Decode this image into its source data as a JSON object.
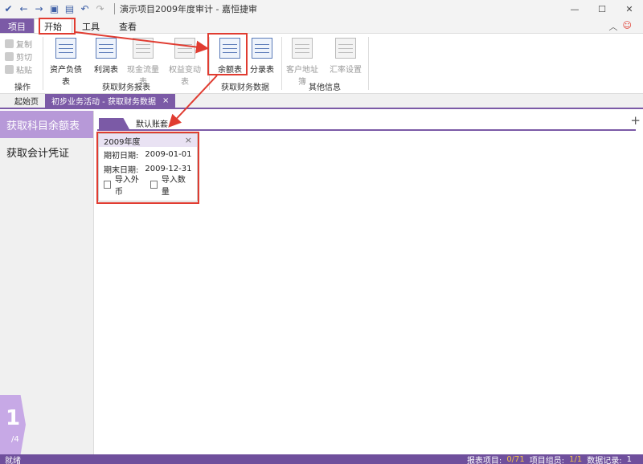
{
  "titlebar": {
    "title": "演示项目2009年度审计 - 嘉恒捷审",
    "icons": [
      "app-icon",
      "back-icon",
      "forward-icon",
      "save-icon",
      "save-as-icon",
      "undo-icon",
      "redo-icon"
    ],
    "window_buttons": [
      "minimize",
      "maximize",
      "close"
    ]
  },
  "tabs": {
    "project": "项目",
    "items": [
      "开始",
      "工具",
      "查看"
    ],
    "active": "开始"
  },
  "ribbon": {
    "ops": {
      "copy": "复制",
      "cut": "剪切",
      "paste": "粘贴",
      "label": "操作"
    },
    "reports": {
      "label": "获取财务报表",
      "items": [
        "资产负债表",
        "利润表",
        "现金流量表",
        "权益变动表"
      ]
    },
    "financial": {
      "label": "获取财务数据",
      "items": [
        "余额表",
        "分录表"
      ]
    },
    "other": {
      "label": "其他信息",
      "items": [
        "客户地址簿",
        "汇率设置"
      ]
    }
  },
  "doctabs": {
    "home": "起始页",
    "active": "初步业务活动 - 获取财务数据",
    "close": "×"
  },
  "leftnav": {
    "items": [
      "获取科目余额表",
      "获取会计凭证"
    ],
    "active_index": 0,
    "page_num": "1",
    "page_total": "/4"
  },
  "content": {
    "ledger_label": "默认账套",
    "plus": "+",
    "year_card": {
      "title": "2009年度",
      "close": "×",
      "start_label": "期初日期:",
      "start_value": "2009-01-01",
      "end_label": "期末日期:",
      "end_value": "2009-12-31",
      "import_foreign": "导入外币",
      "import_qty": "导入数量"
    }
  },
  "status": {
    "left": "就绪",
    "report_label": "报表项目:",
    "report_value": "0/71",
    "group_label": "项目组员:",
    "group_value": "1/1",
    "records_label": "数据记录:",
    "records_value": "1"
  },
  "colors": {
    "accent": "#7b5aa6",
    "nav_active": "#b799d8",
    "annotation": "#e03c31",
    "status_highlight": "#f0c24b"
  }
}
